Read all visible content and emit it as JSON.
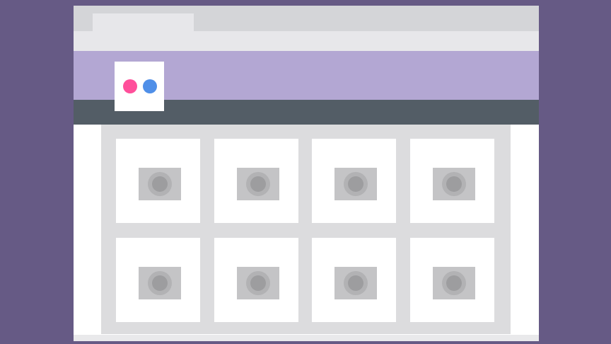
{
  "colors": {
    "background": "#665a85",
    "tab_strip": "#d4d5d8",
    "address_bar": "#e7e7ea",
    "header_band": "#b3a7d3",
    "nav_bar": "#535d66",
    "grid_panel": "#dcdcde",
    "card": "#ffffff",
    "logo_dot_pink": "#ff4f9a",
    "logo_dot_blue": "#4f8fe8"
  },
  "logo": {
    "icon": "flickr-logo-icon"
  },
  "gallery": {
    "photos": [
      {
        "icon": "photo-placeholder-icon"
      },
      {
        "icon": "photo-placeholder-icon"
      },
      {
        "icon": "photo-placeholder-icon"
      },
      {
        "icon": "photo-placeholder-icon"
      },
      {
        "icon": "photo-placeholder-icon"
      },
      {
        "icon": "photo-placeholder-icon"
      },
      {
        "icon": "photo-placeholder-icon"
      },
      {
        "icon": "photo-placeholder-icon"
      }
    ]
  }
}
